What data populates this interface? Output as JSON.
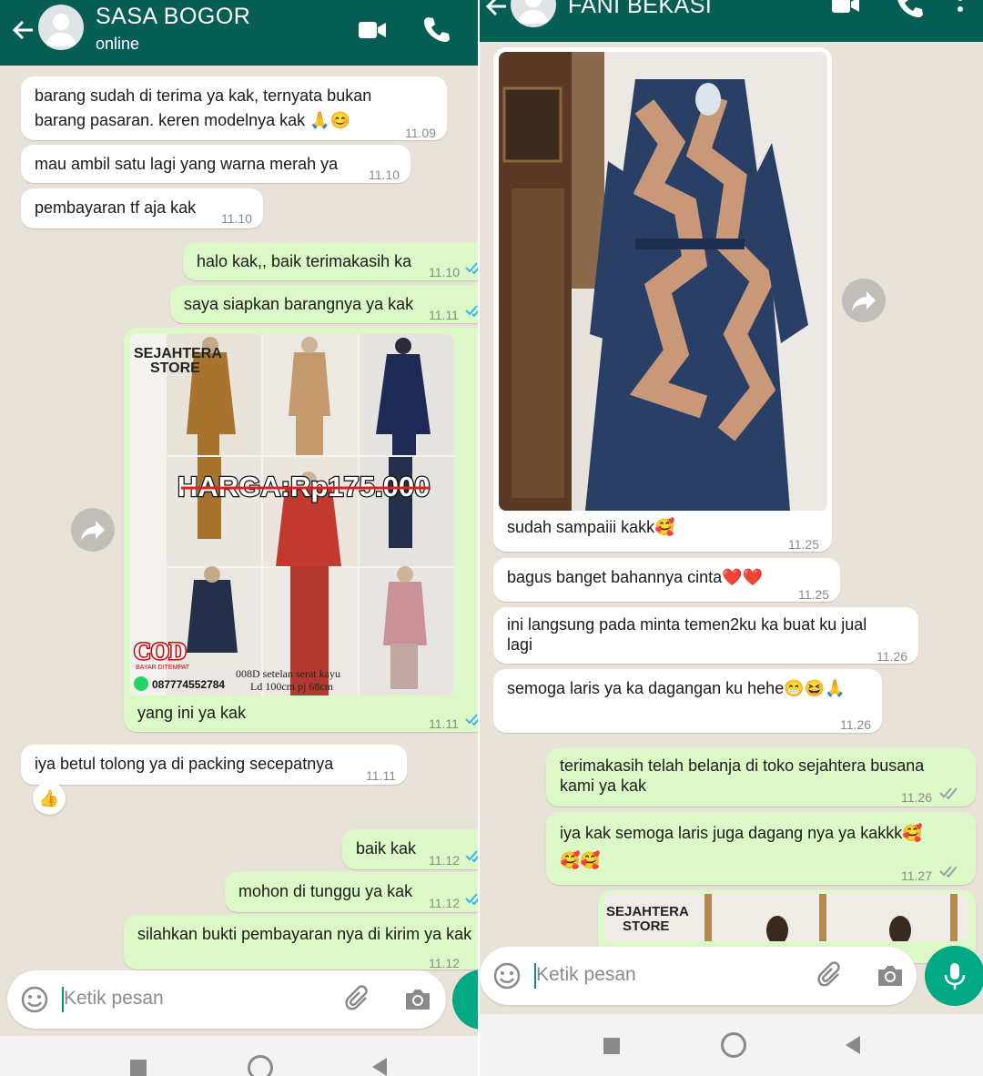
{
  "left_chat": {
    "contact_name": "SASA BOGOR",
    "status": "online",
    "messages": [
      {
        "text": "barang sudah di terima ya kak, ternyata bukan\nbarang pasaran. keren modelnya kak 🙏😊",
        "time": "11.09"
      },
      {
        "text": "mau ambil satu lagi yang warna merah ya",
        "time": "11.10"
      },
      {
        "text": "pembayaran tf aja kak",
        "time": "11.10"
      },
      {
        "text": "halo kak,, baik terimakasih ka",
        "time": "11.10"
      },
      {
        "text": "saya siapkan barangnya ya kak",
        "time": "11.11"
      },
      {
        "text": "yang ini ya kak",
        "time": "11.11"
      },
      {
        "text": "iya betul tolong ya di packing secepatnya",
        "time": "11.11"
      },
      {
        "text": "baik kak",
        "time": "11.12"
      },
      {
        "text": "mohon di tunggu ya kak",
        "time": "11.12"
      },
      {
        "text": "silahkan bukti pembayaran nya di kirim ya kak",
        "time": "11.12"
      }
    ],
    "reaction": "👍",
    "product_image": {
      "store_name_line1": "SEJAHTERA",
      "store_name_line2": "STORE",
      "price_banner": "HARGA:Rp175.000",
      "cod_label": "COD",
      "cod_sub": "BAYAR DITEMPAT",
      "phone": "087774552784",
      "caption_line1": "008D setelan serat kayu",
      "caption_line2": "Ld 100cm pj 68cm",
      "colors": [
        "#a8732e",
        "#c49a6c",
        "#1c2a55",
        "#b8352c",
        "#c2392f",
        "#c0a7a0",
        "#24304a",
        "#b33a30",
        "#c9919a"
      ]
    },
    "input_placeholder": "Ketik pesan"
  },
  "right_chat": {
    "contact_name": "FANI BEKASI",
    "messages": [
      {
        "text": "sudah sampaiii kakk🥰",
        "time": "11.25"
      },
      {
        "text": "bagus banget bahannya cinta❤️❤️",
        "time": "11.25"
      },
      {
        "text": "ini langsung pada minta temen2ku ka buat ku jual\nlagi",
        "time": "11.26"
      },
      {
        "text": "semoga laris ya ka dagangan ku hehe😁😆🙏",
        "time": "11.26"
      },
      {
        "text": "terimakasih telah belanja di toko sejahtera busana\nkami ya kak",
        "time": "11.26"
      },
      {
        "text": "iya kak semoga laris juga dagang nya ya kakkk🥰\n🥰🥰",
        "time": "11.27"
      }
    ],
    "preview_store_line1": "SEJAHTERA",
    "preview_store_line2": "STORE",
    "input_placeholder": "Ketik pesan"
  },
  "colors": {
    "header": "#075e54",
    "chat_bg": "#e9e2d8",
    "outgoing_bubble": "#dcf8c6",
    "incoming_bubble": "#ffffff",
    "read_tick": "#34b7f1",
    "delivered_tick": "#9aa0a6",
    "mic_button": "#00a884"
  }
}
